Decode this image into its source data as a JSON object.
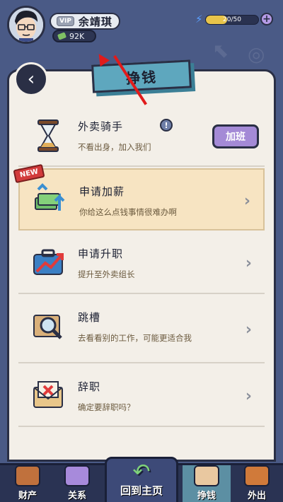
{
  "header": {
    "vip_label": "VIP",
    "player_name": "余靖琪",
    "money": "92K",
    "energy_text": "20/50",
    "energy_fraction": 0.4
  },
  "panel": {
    "title": "挣钱"
  },
  "rows": [
    {
      "title": "外卖骑手",
      "desc": "不看出身，加入我们",
      "button": "加班",
      "info": "!"
    },
    {
      "badge": "NEW",
      "title": "申请加薪",
      "desc": "你给这么点钱事情很难办啊"
    },
    {
      "title": "申请升职",
      "desc": "提升至外卖组长"
    },
    {
      "title": "跳槽",
      "desc": "去看看别的工作，可能更适合我"
    },
    {
      "title": "辞职",
      "desc": "确定要辞职吗？"
    }
  ],
  "nav": {
    "assets": "财产",
    "relations": "关系",
    "home": "回到主页",
    "earn": "挣钱",
    "outing": "外出"
  }
}
